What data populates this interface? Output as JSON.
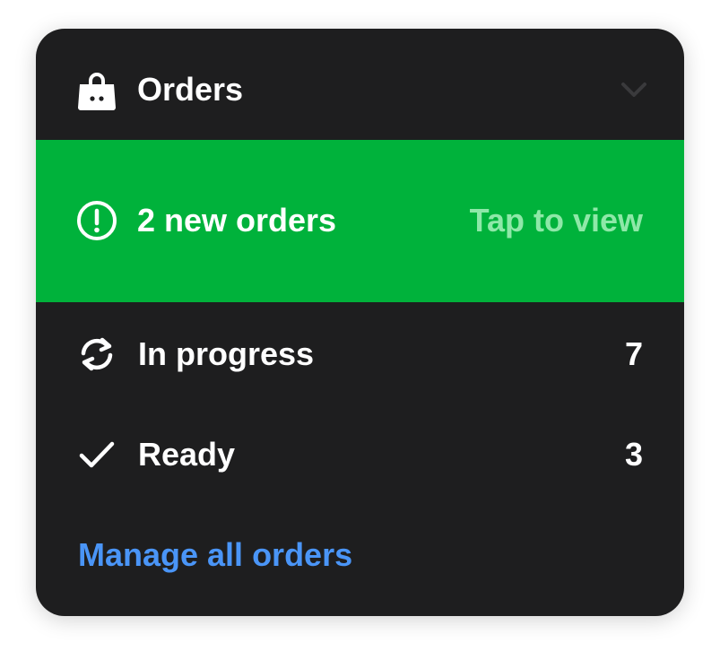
{
  "header": {
    "title": "Orders",
    "icon": "shopping-bag-icon",
    "chevron_icon": "chevron-down-icon"
  },
  "alert": {
    "icon": "alert-circle-icon",
    "text": "2 new orders",
    "action": "Tap to view",
    "background": "#00b23b"
  },
  "rows": [
    {
      "icon": "refresh-icon",
      "label": "In progress",
      "count": "7"
    },
    {
      "icon": "checkmark-icon",
      "label": "Ready",
      "count": "3"
    }
  ],
  "footer": {
    "link": "Manage all orders",
    "link_color": "#4a95f7"
  },
  "colors": {
    "card_background": "#1e1e1f",
    "text": "#ffffff",
    "tap_text": "#8ee8a8"
  }
}
